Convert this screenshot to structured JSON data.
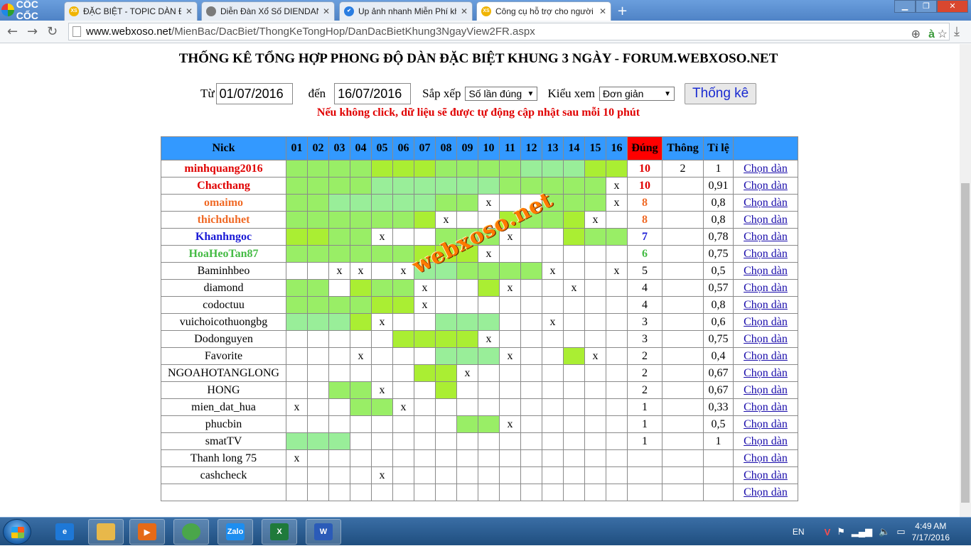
{
  "browser": {
    "brand": "CỐC CỐC",
    "tabs": [
      {
        "icon": "xoso-icon",
        "badge": "XS",
        "title": "ĐẶC BIỆT - TOPIC DÀN ĐẶC",
        "active": false
      },
      {
        "icon": "page-icon",
        "badge": "",
        "title": "Diễn Đàn Xổ Số DIENDAN",
        "active": false
      },
      {
        "icon": "checkbox-icon",
        "badge": "✔",
        "title": "Up ảnh nhanh Miễn Phí không",
        "active": false
      },
      {
        "icon": "xoso-icon",
        "badge": "XS",
        "title": "Công cụ hỗ trợ cho người",
        "active": true
      }
    ],
    "url_host": "www.webxoso.net",
    "url_path": "/MienBac/DacBiet/ThongKeTongHop/DanDacBietKhung3NgayView2FR.aspx"
  },
  "page": {
    "title": "THỐNG KÊ TỔNG HỢP PHONG ĐỘ DÀN ĐẶC BIỆT KHUNG 3 NGÀY - FORUM.WEBXOSO.NET",
    "from_label": "Từ",
    "from_value": "01/07/2016",
    "to_label": "đến",
    "to_value": "16/07/2016",
    "sort_label": "Sắp xếp",
    "sort_value": "Số lần đúng",
    "view_label": "Kiểu xem",
    "view_value": "Đơn giản",
    "submit_label": "Thống kê",
    "notice": "Nếu không click, dữ liệu sẽ được tự động cập nhật sau mỗi 10 phút",
    "watermark": "webxoso.net"
  },
  "table": {
    "headers": {
      "nick": "Nick",
      "days": [
        "01",
        "02",
        "03",
        "04",
        "05",
        "06",
        "07",
        "08",
        "09",
        "10",
        "11",
        "12",
        "13",
        "14",
        "15",
        "16"
      ],
      "hits": "Đúng",
      "thong": "Thông",
      "ratio": "Tỉ lệ"
    },
    "pick_label": "Chọn dàn",
    "colors": {
      "g1": "#99ee66",
      "g2": "#aaee33",
      "g3": "#99ee99",
      "red": "#e00000",
      "orange": "#f06a26",
      "blue": "#1a1ad6",
      "green": "#44bb44"
    },
    "rows": [
      {
        "nick": "minhquang2016",
        "color": "#e00000",
        "bold": true,
        "cells": [
          "g1",
          "g1",
          "g1",
          "g1",
          "g2",
          "g2",
          "g2",
          "g1",
          "g1",
          "g1",
          "g1",
          "g3",
          "g3",
          "g3",
          "g2",
          "g2"
        ],
        "hits": "10",
        "thong": "2",
        "ratio": "1"
      },
      {
        "nick": "Chacthang",
        "color": "#e00000",
        "bold": true,
        "cells": [
          "g1",
          "g1",
          "g1",
          "g1",
          "g3",
          "g3",
          "g3",
          "g3",
          "g3",
          "g3",
          "g1",
          "g1",
          "g1",
          "g1",
          "g1",
          "x"
        ],
        "hits": "10",
        "thong": "",
        "ratio": "0,91"
      },
      {
        "nick": "omaimo",
        "color": "#f06a26",
        "bold": true,
        "cells": [
          "g1",
          "g1",
          "g3",
          "g3",
          "g3",
          "g3",
          "g3",
          "g1",
          "g1",
          "x",
          "",
          "",
          "g1",
          "g1",
          "g1",
          "x"
        ],
        "hits": "8",
        "thong": "",
        "ratio": "0,8"
      },
      {
        "nick": "thichduhet",
        "color": "#f06a26",
        "bold": true,
        "cells": [
          "g1",
          "g1",
          "g1",
          "g1",
          "g1",
          "g1",
          "g2",
          "x",
          "",
          "",
          "g2",
          "g1",
          "g1",
          "g2",
          "x",
          ""
        ],
        "hits": "8",
        "thong": "",
        "ratio": "0,8"
      },
      {
        "nick": "Khanhngoc",
        "color": "#1a1ad6",
        "bold": true,
        "cells": [
          "g2",
          "g2",
          "g1",
          "g1",
          "x",
          "",
          "",
          "g1",
          "g1",
          "g1",
          "x",
          "",
          "",
          "g2",
          "g1",
          "g1"
        ],
        "hits": "7",
        "thong": "",
        "ratio": "0,78"
      },
      {
        "nick": "HoaHeoTan87",
        "color": "#44bb44",
        "bold": true,
        "cells": [
          "g1",
          "g1",
          "g1",
          "g1",
          "g1",
          "g1",
          "g2",
          "g2",
          "g2",
          "x",
          "",
          "",
          "",
          "",
          "",
          ""
        ],
        "hits": "6",
        "thong": "",
        "ratio": "0,75"
      },
      {
        "nick": "Baminhbeo",
        "color": "#000000",
        "bold": false,
        "cells": [
          "",
          "",
          "x",
          "x",
          "",
          "x",
          "g3",
          "g3",
          "g1",
          "g1",
          "g1",
          "g1",
          "x",
          "",
          "",
          "x"
        ],
        "hits": "5",
        "thong": "",
        "ratio": "0,5"
      },
      {
        "nick": "diamond",
        "color": "#000000",
        "bold": false,
        "cells": [
          "g1",
          "g1",
          "",
          "g2",
          "g1",
          "g1",
          "x",
          "",
          "",
          "g2",
          "x",
          "",
          "",
          "x",
          "",
          ""
        ],
        "hits": "4",
        "thong": "",
        "ratio": "0,57"
      },
      {
        "nick": "codoctuu",
        "color": "#000000",
        "bold": false,
        "cells": [
          "g1",
          "g1",
          "g1",
          "g1",
          "g2",
          "g2",
          "x",
          "",
          "",
          "",
          "",
          "",
          "",
          "",
          "",
          ""
        ],
        "hits": "4",
        "thong": "",
        "ratio": "0,8"
      },
      {
        "nick": "vuichoicothuongbg",
        "color": "#000000",
        "bold": false,
        "cells": [
          "g3",
          "g3",
          "g3",
          "g2",
          "x",
          "",
          "",
          "g3",
          "g3",
          "g3",
          "",
          "",
          "x",
          "",
          "",
          ""
        ],
        "hits": "3",
        "thong": "",
        "ratio": "0,6"
      },
      {
        "nick": "Dodonguyen",
        "color": "#000000",
        "bold": false,
        "cells": [
          "",
          "",
          "",
          "",
          "",
          "g2",
          "g2",
          "g2",
          "g2",
          "x",
          "",
          "",
          "",
          "",
          "",
          ""
        ],
        "hits": "3",
        "thong": "",
        "ratio": "0,75"
      },
      {
        "nick": "Favorite",
        "color": "#000000",
        "bold": false,
        "cells": [
          "",
          "",
          "",
          "x",
          "",
          "",
          "",
          "g3",
          "g3",
          "g3",
          "x",
          "",
          "",
          "g2",
          "x",
          ""
        ],
        "hits": "2",
        "thong": "",
        "ratio": "0,4"
      },
      {
        "nick": "NGOAHOTANGLONG",
        "color": "#000000",
        "bold": false,
        "cells": [
          "",
          "",
          "",
          "",
          "",
          "",
          "g2",
          "g2",
          "x",
          "",
          "",
          "",
          "",
          "",
          "",
          ""
        ],
        "hits": "2",
        "thong": "",
        "ratio": "0,67"
      },
      {
        "nick": "HONG",
        "color": "#000000",
        "bold": false,
        "cells": [
          "",
          "",
          "g1",
          "g1",
          "x",
          "",
          "",
          "g2",
          "",
          "",
          "",
          "",
          "",
          "",
          "",
          ""
        ],
        "hits": "2",
        "thong": "",
        "ratio": "0,67"
      },
      {
        "nick": "mien_dat_hua",
        "color": "#000000",
        "bold": false,
        "cells": [
          "x",
          "",
          "",
          "g1",
          "g1",
          "x",
          "",
          "",
          "",
          "",
          "",
          "",
          "",
          "",
          "",
          ""
        ],
        "hits": "1",
        "thong": "",
        "ratio": "0,33"
      },
      {
        "nick": "phucbin",
        "color": "#000000",
        "bold": false,
        "cells": [
          "",
          "",
          "",
          "",
          "",
          "",
          "",
          "",
          "g1",
          "g1",
          "x",
          "",
          "",
          "",
          "",
          ""
        ],
        "hits": "1",
        "thong": "",
        "ratio": "0,5"
      },
      {
        "nick": "smatTV",
        "color": "#000000",
        "bold": false,
        "cells": [
          "g3",
          "g3",
          "g3",
          "",
          "",
          "",
          "",
          "",
          "",
          "",
          "",
          "",
          "",
          "",
          "",
          ""
        ],
        "hits": "1",
        "thong": "",
        "ratio": "1"
      },
      {
        "nick": "Thanh long 75",
        "color": "#000000",
        "bold": false,
        "cells": [
          "x",
          "",
          "",
          "",
          "",
          "",
          "",
          "",
          "",
          "",
          "",
          "",
          "",
          "",
          "",
          ""
        ],
        "hits": "",
        "thong": "",
        "ratio": ""
      },
      {
        "nick": "cashcheck",
        "color": "#000000",
        "bold": false,
        "cells": [
          "",
          "",
          "",
          "",
          "x",
          "",
          "",
          "",
          "",
          "",
          "",
          "",
          "",
          "",
          "",
          ""
        ],
        "hits": "",
        "thong": "",
        "ratio": ""
      },
      {
        "nick": "",
        "color": "#000000",
        "bold": false,
        "cells": [
          "",
          "",
          "",
          "",
          "",
          "",
          "",
          "",
          "",
          "",
          "",
          "",
          "",
          "",
          "",
          ""
        ],
        "hits": "",
        "thong": "",
        "ratio": ""
      }
    ]
  },
  "taskbar": {
    "apps": [
      {
        "name": "ie-icon",
        "label": "e",
        "color": "#1e78d7"
      },
      {
        "name": "explorer-icon",
        "label": "",
        "color": "#e8b84a"
      },
      {
        "name": "media-player-icon",
        "label": "▶",
        "color": "#e56a17"
      },
      {
        "name": "coccoc-icon",
        "label": "",
        "color": "#4aa64a"
      },
      {
        "name": "zalo-icon",
        "label": "Zalo",
        "color": "#1d8ef0"
      },
      {
        "name": "excel-icon",
        "label": "X",
        "color": "#1f7a3b"
      },
      {
        "name": "word-icon",
        "label": "W",
        "color": "#2b5bb8"
      }
    ],
    "lang": "EN",
    "time": "4:49 AM",
    "date": "7/17/2016"
  }
}
